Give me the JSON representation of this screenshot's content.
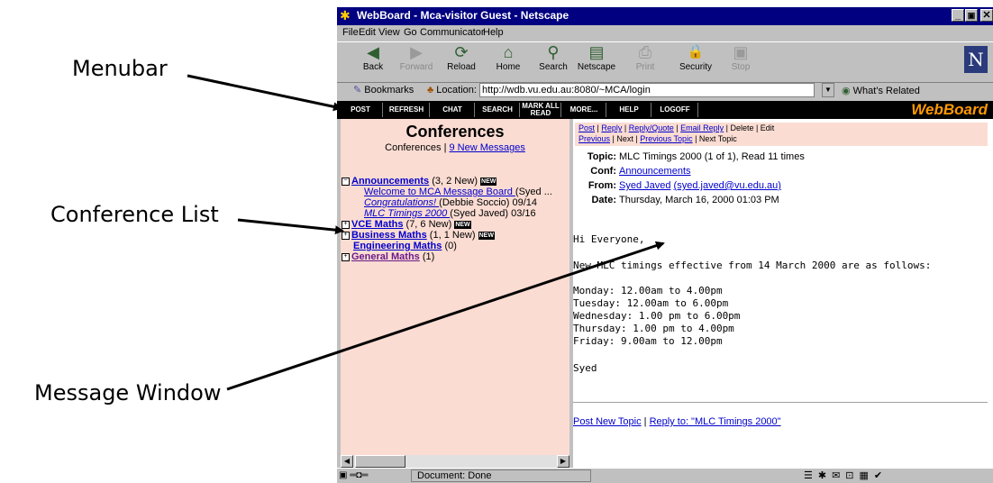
{
  "annotations": {
    "menubar": "Menubar",
    "conference_list": "Conference List",
    "message_window": "Message Window"
  },
  "window": {
    "title": "WebBoard - Mca-visitor Guest - Netscape",
    "minimize": "_",
    "maximize": "▣",
    "close": "✕"
  },
  "menus": [
    "File",
    "Edit",
    "View",
    "Go",
    "Communicator",
    "Help"
  ],
  "toolbar": [
    {
      "label": "Back",
      "icon": "back-arrow-icon",
      "glyph": "◀"
    },
    {
      "label": "Forward",
      "icon": "forward-arrow-icon",
      "glyph": "▶"
    },
    {
      "label": "Reload",
      "icon": "reload-icon",
      "glyph": "⟳"
    },
    {
      "label": "Home",
      "icon": "home-icon",
      "glyph": "⌂"
    },
    {
      "label": "Search",
      "icon": "search-icon",
      "glyph": "⚲"
    },
    {
      "label": "Netscape",
      "icon": "netscape-icon",
      "glyph": "▤"
    },
    {
      "label": "Print",
      "icon": "print-icon",
      "glyph": "⎙"
    },
    {
      "label": "Security",
      "icon": "lock-icon",
      "glyph": "🔒"
    },
    {
      "label": "Stop",
      "icon": "stop-icon",
      "glyph": "▣"
    }
  ],
  "netscape_logo": "N",
  "location": {
    "bookmarks": "Bookmarks",
    "label": "Location:",
    "url": "http://wdb.vu.edu.au:8080/~MCA/login",
    "related": "What's Related"
  },
  "webboard": {
    "buttons": [
      "POST",
      "REFRESH",
      "CHAT",
      "SEARCH",
      "MARK ALL READ",
      "MORE...",
      "HELP",
      "LOGOFF"
    ],
    "logo": "WebBoard",
    "logo_color": "#ff9900"
  },
  "conferences": {
    "heading": "Conferences",
    "sub_prefix": "Conferences | ",
    "sub_link": "9 New Messages",
    "items": [
      {
        "name": "Announcements",
        "count": " (3, 2 New) ",
        "new": "NEW",
        "expanded": "−"
      },
      {
        "name": "VCE Maths",
        "count": " (7, 6 New) ",
        "new": "NEW",
        "expanded": "+"
      },
      {
        "name": "Business Maths",
        "count": " (1, 1 New) ",
        "new": "NEW",
        "expanded": "+"
      },
      {
        "name": "Engineering Maths",
        "count": " (0)"
      },
      {
        "name": "General Maths",
        "count": " (1)",
        "expanded": "+"
      }
    ],
    "messages": [
      {
        "title": "Welcome to MCA Message Board ",
        "meta": "(Syed ..."
      },
      {
        "title": "Congratulations! ",
        "meta": "(Debbie Soccio) 09/14"
      },
      {
        "title": "MLC Timings 2000 ",
        "meta": "(Syed Javed) 03/16"
      }
    ]
  },
  "message": {
    "nav_line1": {
      "post": "Post",
      "reply": "Reply",
      "reply_quote": "Reply/Quote",
      "email_reply": "Email Reply",
      "rest": " | Delete | Edit"
    },
    "nav_line2": {
      "previous": "Previous",
      "next": " | Next | ",
      "previous_topic": "Previous Topic",
      "next_topic": " | Next Topic"
    },
    "topic_label": "Topic:",
    "topic": "MLC Timings 2000 (1 of 1), Read 11 times",
    "conf_label": "Conf:",
    "conf": "Announcements",
    "from_label": "From:",
    "from_name": "Syed Javed",
    "from_email": "(syed.javed@vu.edu.au)",
    "date_label": "Date:",
    "date": "Thursday, March 16, 2000 01:03 PM",
    "body": [
      "Hi Everyone,",
      "",
      "New MLC timings effective from 14 March 2000 are as follows:",
      "",
      "Monday: 12.00am to 4.00pm",
      "Tuesday: 12.00am to 6.00pm",
      "Wednesday: 1.00 pm to 6.00pm",
      "Thursday: 1.00 pm to 4.00pm",
      "Friday: 9.00am to 12.00pm",
      "",
      "Syed"
    ],
    "post_new_topic": "Post New Topic",
    "reply_to": "Reply to: \"MLC Timings 2000\""
  },
  "status": {
    "text": "Document: Done"
  }
}
